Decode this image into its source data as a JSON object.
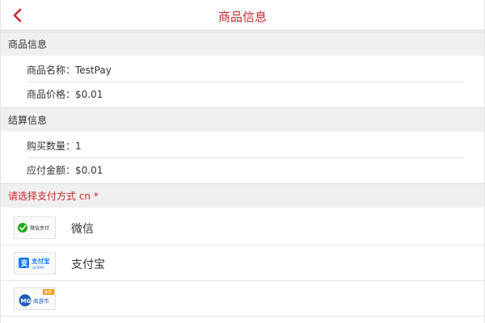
{
  "header": {
    "title": "商品信息"
  },
  "product_section": {
    "title": "商品信息",
    "name_label": "商品名称：",
    "name_value": "TestPay",
    "price_label": "商品价格：",
    "price_value": "$0.01"
  },
  "settlement_section": {
    "title": "结算信息",
    "quantity_label": "购买数量：",
    "quantity_value": "1",
    "amount_label": "应付金额：",
    "amount_value": "$0.01"
  },
  "payment_section": {
    "title": "请选择支付方式 cn *",
    "options": [
      {
        "name": "微信",
        "logo_text": "微信支付",
        "icon": "wechat-pay-icon"
      },
      {
        "name": "支付宝",
        "logo_text": "支付宝",
        "logo_subtext": "ALIPAY",
        "icon": "alipay-icon"
      },
      {
        "name": "",
        "logo_text": "商游币",
        "logo_badge": "推荐",
        "icon": "game-coin-icon"
      }
    ]
  },
  "colors": {
    "accent": "#c8272d",
    "section_bg": "#f0f0f0",
    "wechat_green": "#1aad19",
    "alipay_blue": "#1678ff"
  }
}
